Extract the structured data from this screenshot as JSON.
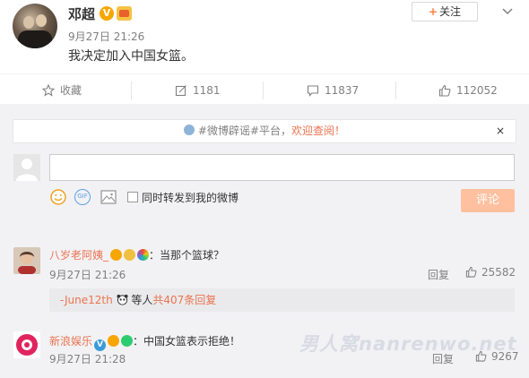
{
  "post": {
    "author": "邓超",
    "verified_badge": "V",
    "time": "9月27日 21:26",
    "content": "我决定加入中国女篮。",
    "follow_label": "关注",
    "follow_plus": "+"
  },
  "actions": {
    "favorite_label": "收藏",
    "repost_count": "1181",
    "comment_count": "11837",
    "like_count": "112052"
  },
  "notice": {
    "prefix": "#微博辟谣#平台，",
    "link": "欢迎查阅！",
    "close": "×"
  },
  "composer": {
    "checkbox_label": "同时转发到我的微博",
    "submit_label": "评论",
    "gif_label": "GIF"
  },
  "comments": [
    {
      "user": "八岁老阿姨_",
      "text": "：当那个篮球？",
      "time": "9月27日 21:26",
      "reply_label": "回复",
      "likes": "25582"
    },
    {
      "user": "新浪娱乐",
      "verified_badge": "V",
      "text": "：中国女篮表示拒绝！",
      "time": "9月27日 21:28",
      "reply_label": "回复",
      "likes": "9267"
    }
  ],
  "subreplies": {
    "user": "-June12th",
    "middle": "等人",
    "link": "共407条回复"
  },
  "watermark": "男人窝nanrenwo.net",
  "colors": {
    "accent": "#eb7350",
    "submit_disabled": "#ffc09f",
    "muted": "#808080",
    "background": "#f2f2f5"
  }
}
